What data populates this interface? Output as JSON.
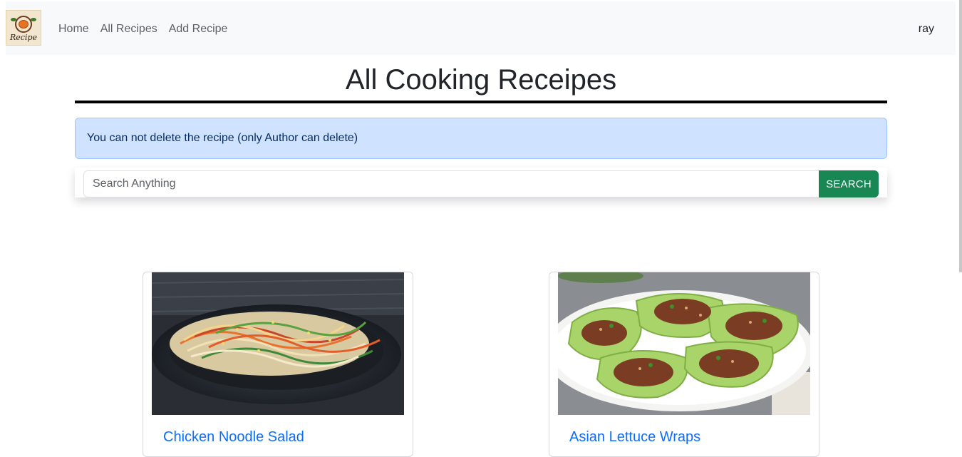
{
  "navbar": {
    "logo_text": "Recipe",
    "links": [
      {
        "label": "Home"
      },
      {
        "label": "All Recipes"
      },
      {
        "label": "Add Recipe"
      }
    ],
    "user": "ray"
  },
  "page": {
    "title": "All Cooking Receipes"
  },
  "alert": {
    "message": "You can not delete the recipe (only Author can delete)",
    "color": "#cfe2ff"
  },
  "search": {
    "placeholder": "Search Anything",
    "value": "",
    "button_label": "SEARCH",
    "button_color": "#198754"
  },
  "recipes": [
    {
      "title": "Chicken Noodle Salad",
      "image": "noodle-salad-photo"
    },
    {
      "title": "Asian Lettuce Wraps",
      "image": "lettuce-wraps-photo"
    }
  ]
}
